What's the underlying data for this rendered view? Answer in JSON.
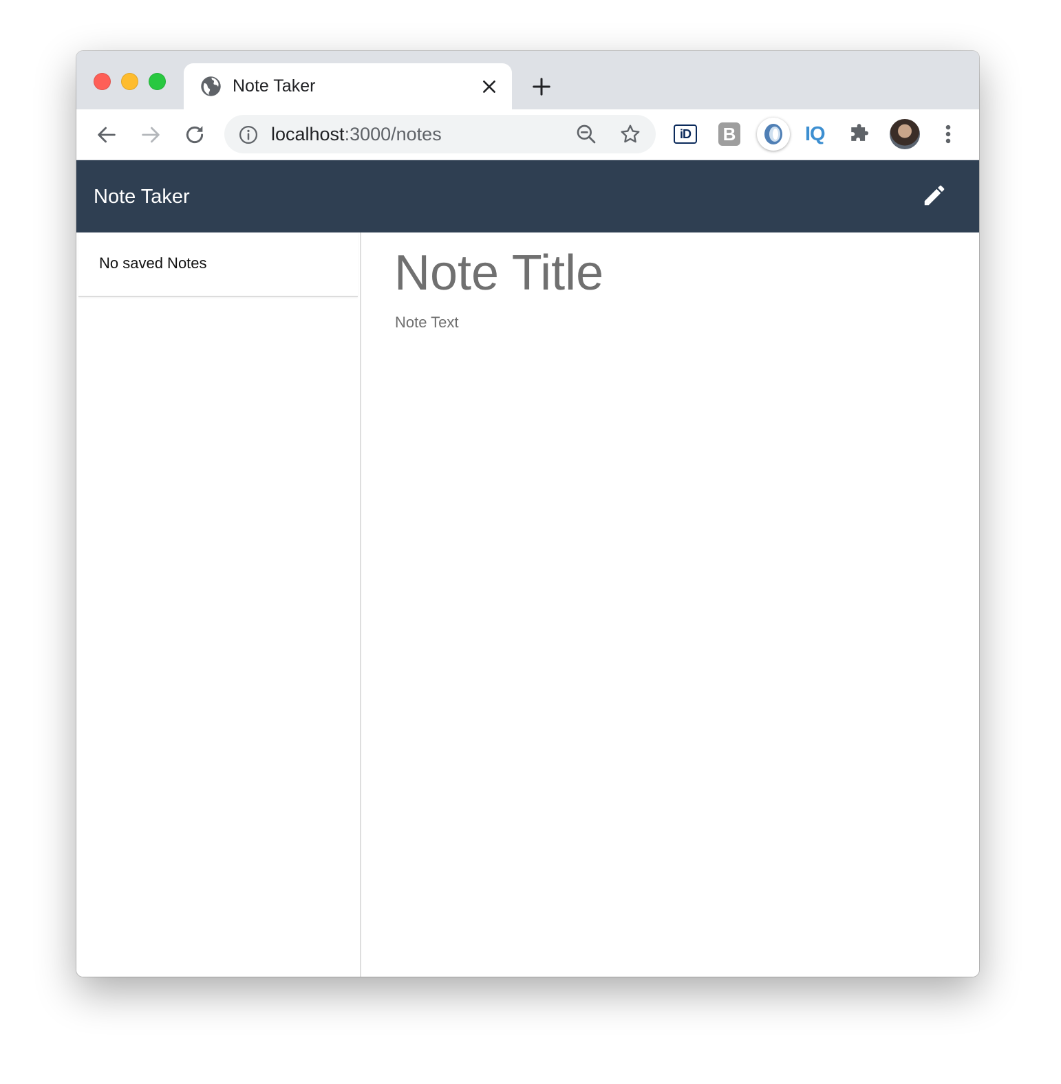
{
  "browser": {
    "tab_title": "Note Taker",
    "url_host": "localhost",
    "url_path": ":3000/notes"
  },
  "extensions": {
    "id_label": "iD",
    "b_label": "B",
    "iq_label": "IQ"
  },
  "app": {
    "brand": "Note Taker"
  },
  "sidebar": {
    "empty_message": "No saved Notes"
  },
  "editor": {
    "title_placeholder": "Note Title",
    "text_placeholder": "Note Text"
  },
  "colors": {
    "navbar": "#2f3f52",
    "tabstrip": "#dee1e6",
    "placeholder": "#707070"
  }
}
